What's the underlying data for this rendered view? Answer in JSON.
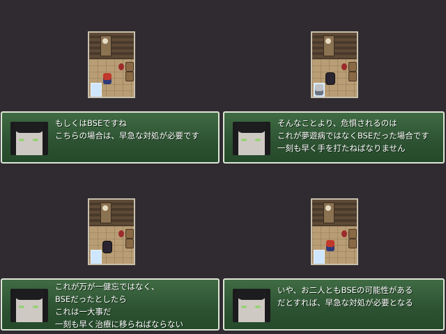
{
  "panels": [
    {
      "lines": [
        "もしくはBSEですね",
        "こちらの場合は、早急な対処が必要です"
      ]
    },
    {
      "lines": [
        "そんなことより、危惧されるのは",
        "これが夢遊病ではなくBSEだった場合です",
        "一刻も早く手を打たねばなりません"
      ]
    },
    {
      "lines": [
        "これが万が一健忘ではなく、",
        "BSEだったとしたら",
        "これは一大事だ",
        "一刻も早く治療に移らねばならない"
      ]
    },
    {
      "lines": [
        "いや、お二人ともBSEの可能性がある",
        "だとすれば、早急な対処が必要となる"
      ]
    }
  ],
  "icons": {
    "speaker_portrait": "dark-haired-woman-portrait-icon",
    "room": "room-map-icon"
  },
  "colors": {
    "background": "#2f2b30",
    "message_box": "#2d5232",
    "message_border": "#dfe6d8",
    "text": "#ffffff"
  }
}
